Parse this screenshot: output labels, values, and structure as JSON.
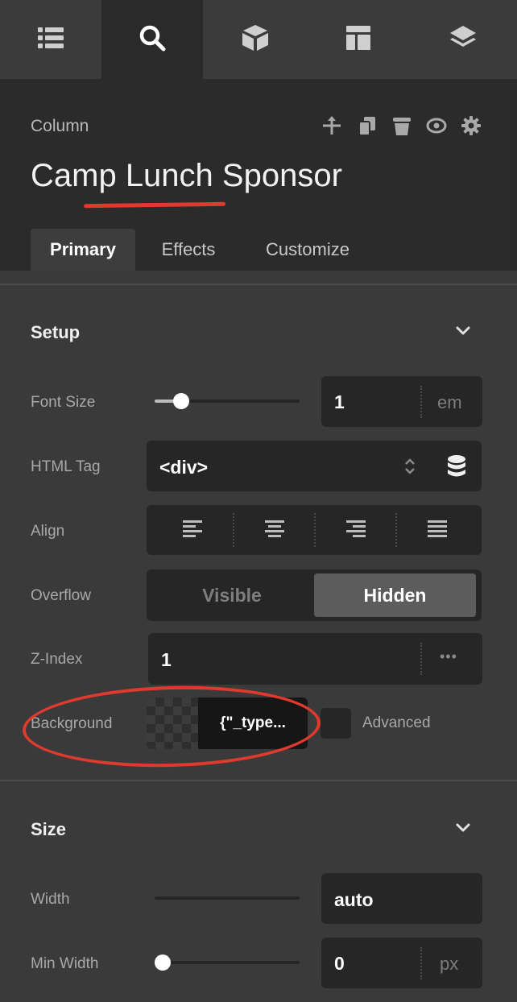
{
  "topbar": {
    "tabs": [
      {
        "icon": "list-icon",
        "active": false
      },
      {
        "icon": "search-icon",
        "active": true
      },
      {
        "icon": "cube-icon",
        "active": false
      },
      {
        "icon": "layout-icon",
        "active": false
      },
      {
        "icon": "layers-icon",
        "active": false
      }
    ]
  },
  "header": {
    "element_type": "Column",
    "title": "Camp Lunch Sponsor",
    "actions": [
      "move-icon",
      "duplicate-icon",
      "trash-icon",
      "eye-icon",
      "gear-icon"
    ],
    "tabs": [
      "Primary",
      "Effects",
      "Customize"
    ],
    "active_tab": "Primary"
  },
  "setup": {
    "title": "Setup",
    "font_size": {
      "label": "Font Size",
      "value": "1",
      "unit": "em",
      "slider_level": 0.15
    },
    "html_tag": {
      "label": "HTML Tag",
      "value": "<div>"
    },
    "align": {
      "label": "Align",
      "options": [
        "align-left-icon",
        "align-center-icon",
        "align-right-icon",
        "align-justify-icon"
      ]
    },
    "overflow": {
      "label": "Overflow",
      "options": [
        "Visible",
        "Hidden"
      ],
      "selected": "Hidden"
    },
    "z_index": {
      "label": "Z-Index",
      "value": "1",
      "more": "•••"
    },
    "background": {
      "label": "Background",
      "value": "{\"_type...",
      "advanced_label": "Advanced"
    }
  },
  "size": {
    "title": "Size",
    "width": {
      "label": "Width",
      "value": "auto"
    },
    "min_width": {
      "label": "Min Width",
      "value": "0",
      "unit": "px",
      "slider_level": 0
    }
  },
  "colors": {
    "accent_annotation": "#e0392d",
    "panel_bg": "#3a3a3a",
    "header_bg": "#2b2b2b",
    "input_bg": "#262626"
  }
}
